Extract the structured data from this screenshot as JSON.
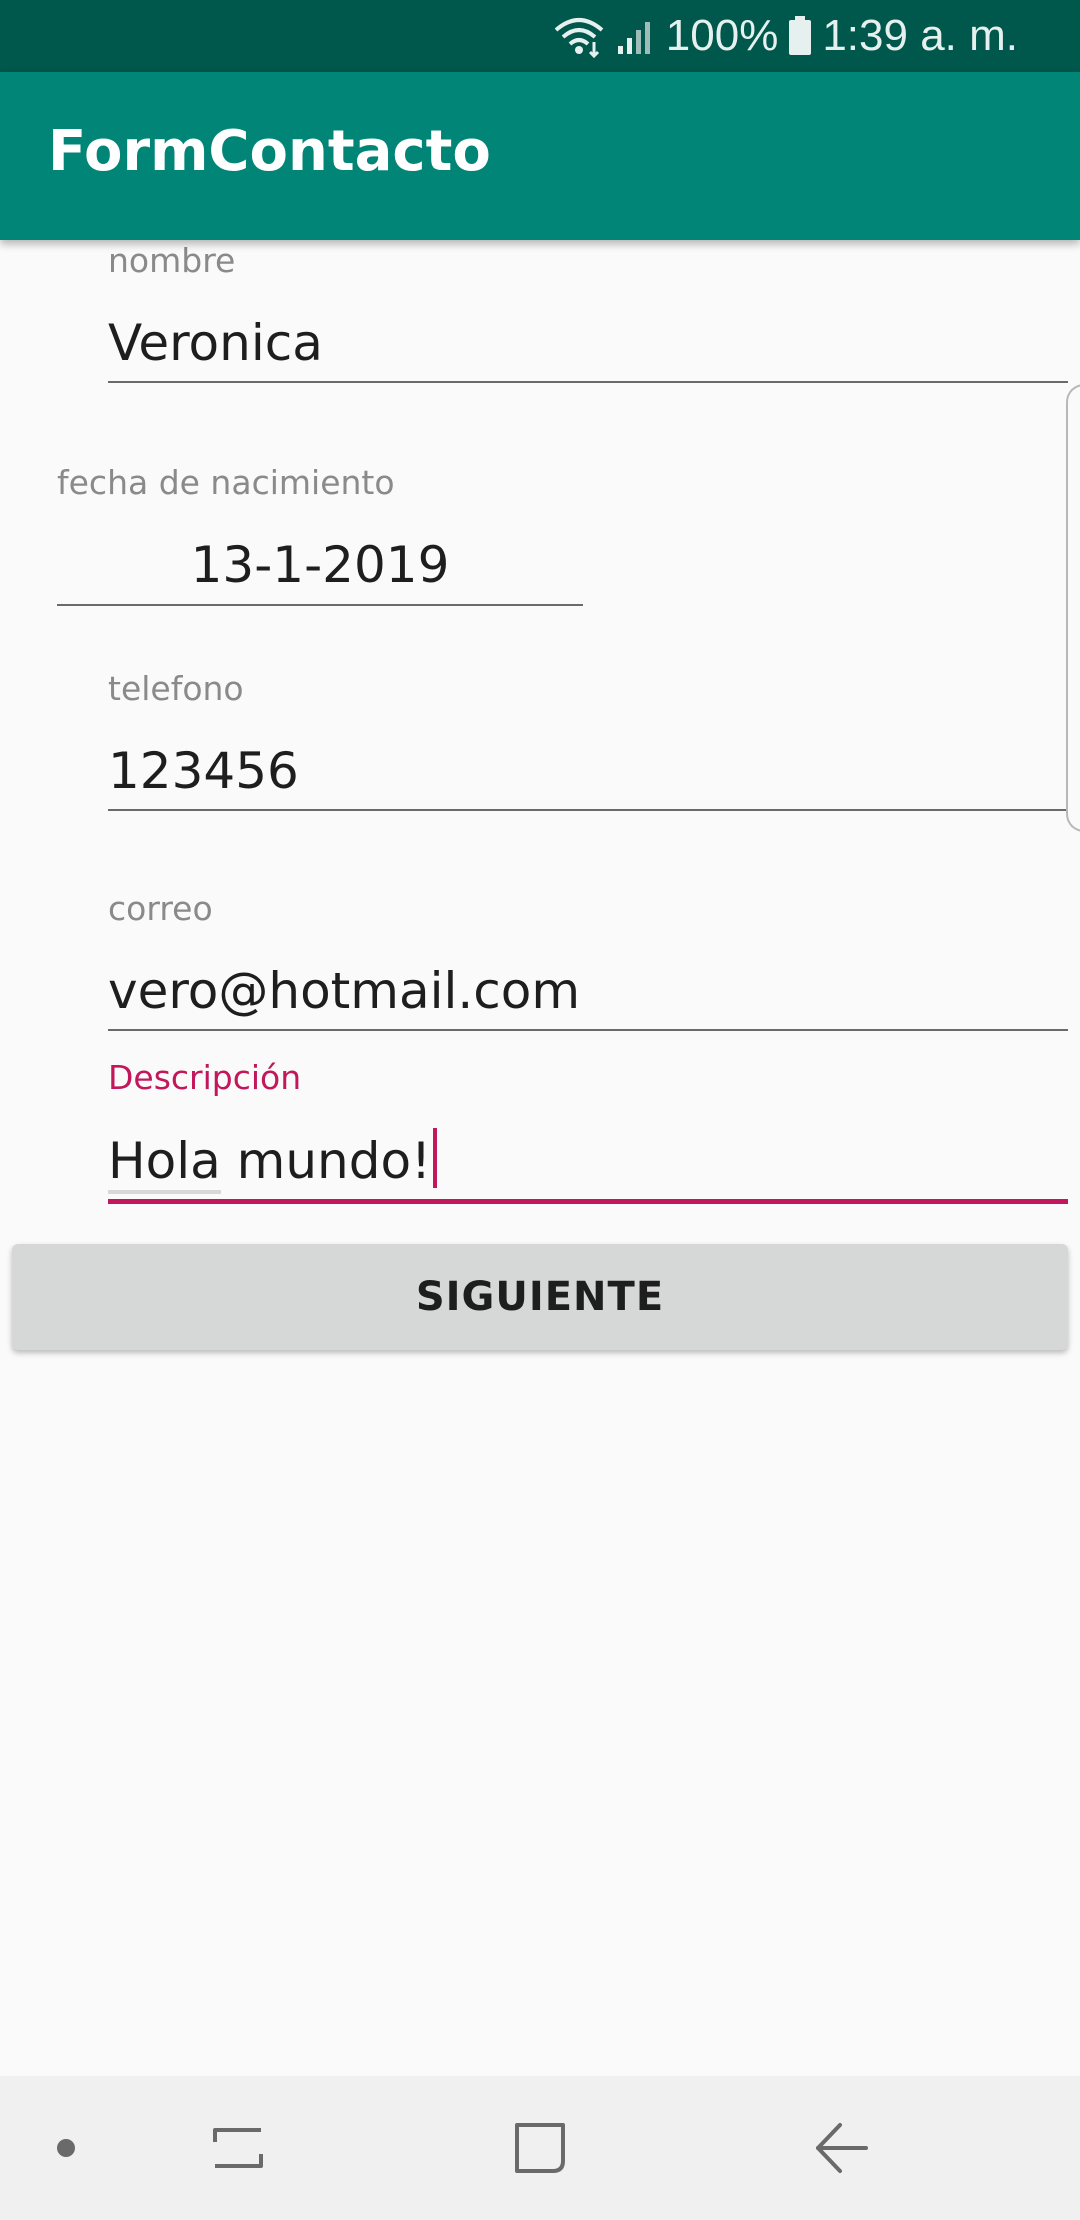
{
  "status_bar": {
    "battery_percent": "100%",
    "time": "1:39 a. m.",
    "icons": [
      "wifi-icon",
      "signal-icon",
      "battery-icon"
    ]
  },
  "app_bar": {
    "title": "FormContacto"
  },
  "form": {
    "nombre": {
      "label": "nombre",
      "value": "Veronica"
    },
    "fecha": {
      "label": "fecha de nacimiento",
      "value": "13-1-2019"
    },
    "telefono": {
      "label": "telefono",
      "value": "123456"
    },
    "correo": {
      "label": "correo",
      "value": "vero@hotmail.com"
    },
    "descripcion": {
      "label": "Descripción",
      "value_part1": "Hola",
      "value_part2": " mundo!"
    }
  },
  "button": {
    "label": "SIGUIENTE"
  },
  "nav_bar": {
    "icons": [
      "dot-icon",
      "recents-icon",
      "home-icon",
      "back-icon"
    ]
  },
  "colors": {
    "status_bar": "#00574b",
    "app_bar": "#008577",
    "accent": "#c2185b",
    "button": "#d6d7d7",
    "background": "#fafafa"
  }
}
